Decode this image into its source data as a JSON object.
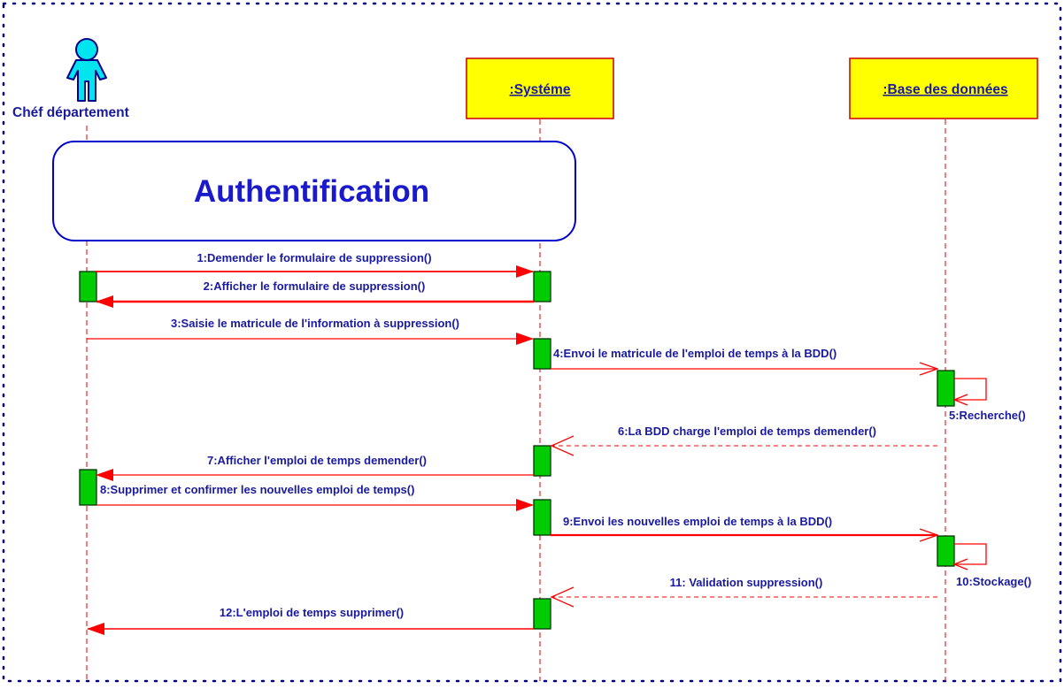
{
  "colors": {
    "frame": "#00008b",
    "label_text": "#1a1a9e",
    "lifeline": "#e00000",
    "lifeline_box_fill": "#ffff00",
    "lifeline_box_border": "#cc0000",
    "activation_fill": "#00cc00",
    "activation_border": "#003300",
    "actor_fill": "#00e5ee",
    "fragment_border": "#0000cc",
    "fragment_text": "#1a1acc"
  },
  "actor": {
    "name": "Chéf département",
    "icon": "stick-person-icon"
  },
  "participants": [
    {
      "key": "systeme",
      "name": ":Systéme"
    },
    {
      "key": "bdd",
      "name": ":Base des données"
    }
  ],
  "fragment": {
    "label": "Authentification"
  },
  "messages": [
    {
      "n": 1,
      "label": "1:Demender le formulaire de suppression()",
      "from": "actor",
      "to": "systeme",
      "kind": "sync"
    },
    {
      "n": 2,
      "label": "2:Afficher le formulaire de suppression()",
      "from": "systeme",
      "to": "actor",
      "kind": "sync"
    },
    {
      "n": 3,
      "label": "3:Saisie le matricule de l'information à suppression()",
      "from": "actor",
      "to": "systeme",
      "kind": "sync"
    },
    {
      "n": 4,
      "label": "4:Envoi le matricule de l'emploi de temps à la BDD()",
      "from": "systeme",
      "to": "bdd",
      "kind": "open"
    },
    {
      "n": 5,
      "label": "5:Recherche()",
      "from": "bdd",
      "to": "bdd",
      "kind": "self"
    },
    {
      "n": 6,
      "label": "6:La BDD charge l'emploi de temps demender()",
      "from": "bdd",
      "to": "systeme",
      "kind": "return"
    },
    {
      "n": 7,
      "label": "7:Afficher l'emploi de temps demender()",
      "from": "systeme",
      "to": "actor",
      "kind": "sync"
    },
    {
      "n": 8,
      "label": "8:Supprimer et confirmer les nouvelles emploi de temps()",
      "from": "actor",
      "to": "systeme",
      "kind": "sync"
    },
    {
      "n": 9,
      "label": "9:Envoi les nouvelles emploi de temps à la BDD()",
      "from": "systeme",
      "to": "bdd",
      "kind": "open"
    },
    {
      "n": 10,
      "label": "10:Stockage()",
      "from": "bdd",
      "to": "bdd",
      "kind": "self"
    },
    {
      "n": 11,
      "label": "11: Validation suppression()",
      "from": "bdd",
      "to": "systeme",
      "kind": "return"
    },
    {
      "n": 12,
      "label": "12:L'emploi de temps supprimer()",
      "from": "systeme",
      "to": "actor",
      "kind": "sync"
    }
  ]
}
